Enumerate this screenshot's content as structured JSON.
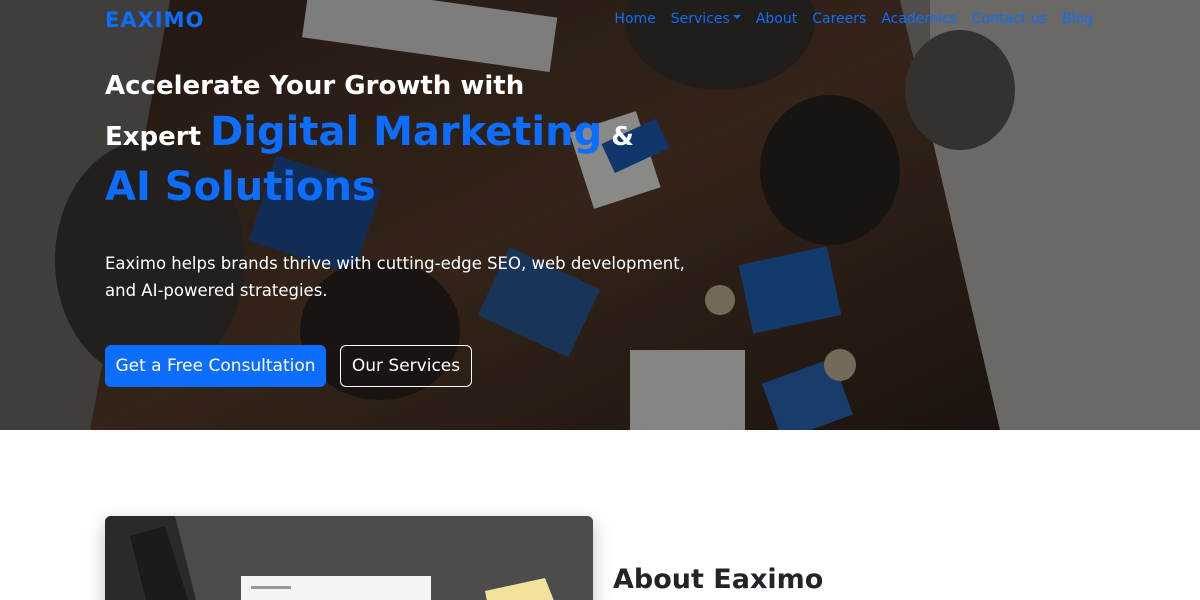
{
  "brand": {
    "name": "EAXIMO"
  },
  "nav": {
    "items": [
      {
        "label": "Home"
      },
      {
        "label": "Services"
      },
      {
        "label": "About"
      },
      {
        "label": "Careers"
      },
      {
        "label": "Academics"
      },
      {
        "label": "Contact us"
      },
      {
        "label": "Blog"
      }
    ]
  },
  "hero": {
    "line1": "Accelerate Your Growth with",
    "line2_prefix": "Expert ",
    "line2_highlight": "Digital Marketing",
    "line2_suffix": " &",
    "line3": "AI Solutions",
    "description": "Eaximo helps brands thrive with cutting-edge SEO, web development, and AI-powered strategies.",
    "primary_button": "Get a Free Consultation",
    "secondary_button": "Our Services"
  },
  "about": {
    "title": "About Eaximo"
  },
  "colors": {
    "accent": "#0d6efd",
    "hero_overlay": "rgba(0,0,0,0.42)",
    "text_dark": "#212529"
  },
  "icons": {
    "services_dropdown": "caret-down-icon"
  }
}
